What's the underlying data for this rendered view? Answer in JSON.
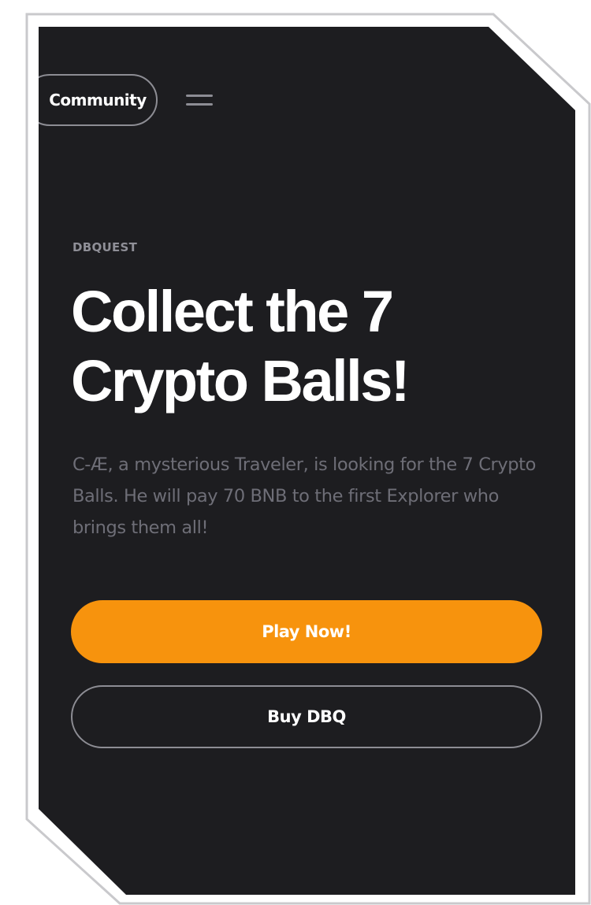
{
  "header": {
    "community_label": "Community",
    "menu_icon": "hamburger-menu-icon"
  },
  "hero": {
    "eyebrow": "DBQUEST",
    "title_line1": "Collect the 7",
    "title_line2": "Crypto Balls!",
    "description": "C-Æ, a mysterious Traveler, is looking for the 7 Crypto Balls. He will pay 70 BNB to the first Explorer who brings them all!"
  },
  "actions": {
    "play_label": "Play Now!",
    "buy_label": "Buy DBQ"
  },
  "colors": {
    "background": "#1d1d20",
    "accent": "#f7930d",
    "muted_text": "#6e6e77",
    "border": "#8d8d94"
  }
}
